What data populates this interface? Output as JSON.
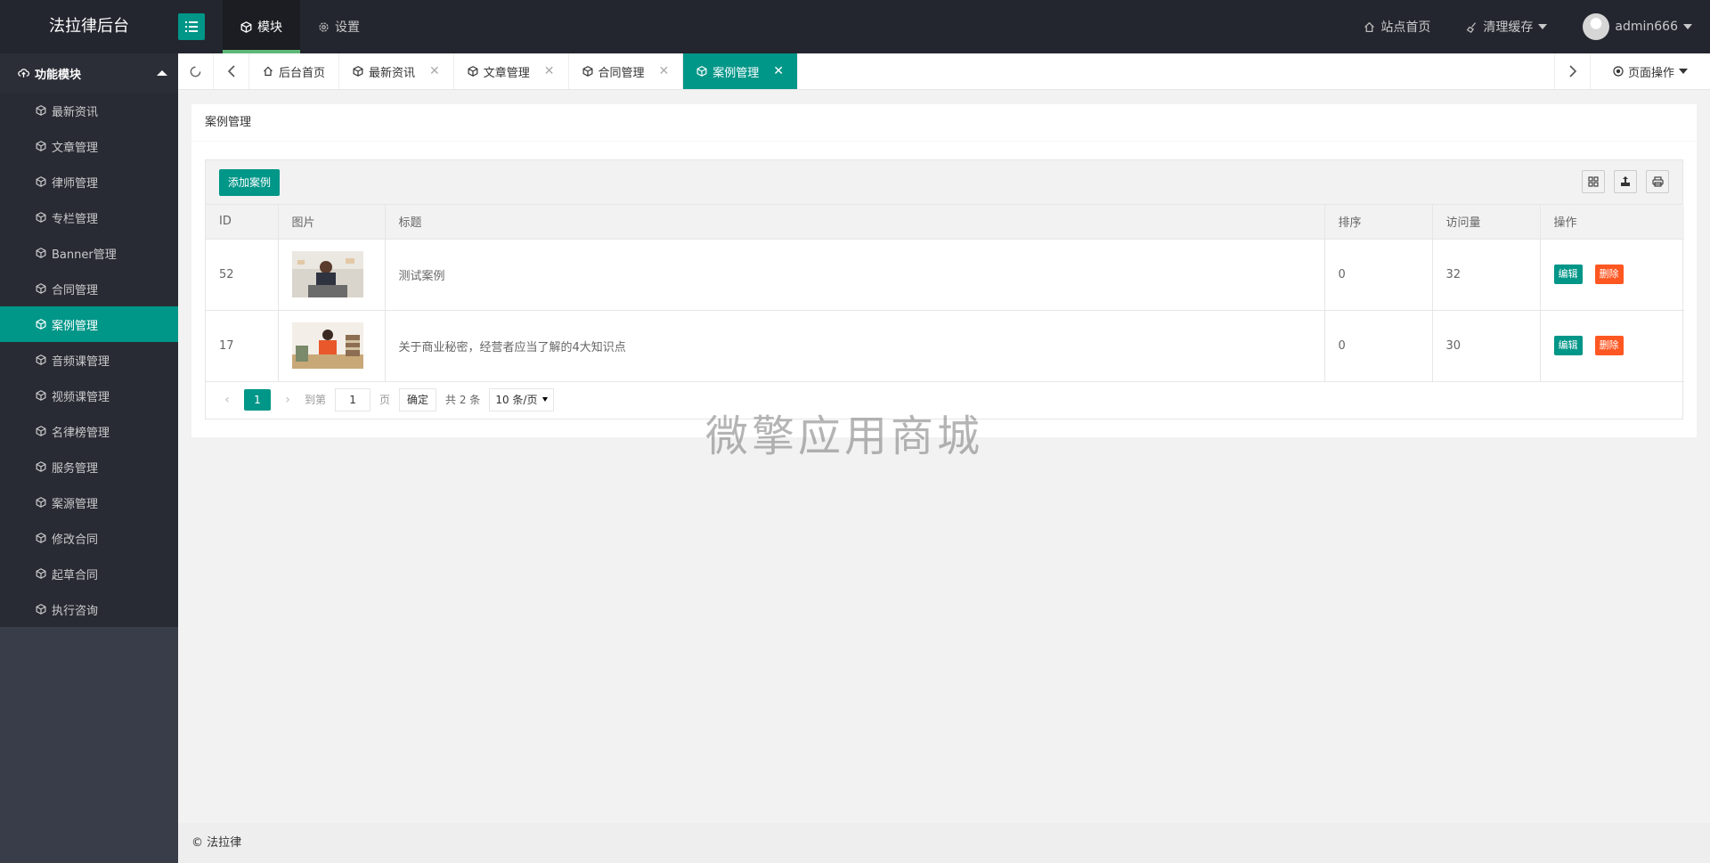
{
  "header": {
    "logo": "法拉律后台",
    "nav": [
      {
        "label": "模块",
        "icon": "cube-icon",
        "active": true
      },
      {
        "label": "设置",
        "icon": "gear-icon",
        "active": false
      }
    ],
    "right": {
      "site_home": "站点首页",
      "clear_cache": "清理缓存",
      "username": "admin666"
    }
  },
  "sidebar": {
    "group_label": "功能模块",
    "items": [
      {
        "label": "最新资讯"
      },
      {
        "label": "文章管理"
      },
      {
        "label": "律师管理"
      },
      {
        "label": "专栏管理"
      },
      {
        "label": "Banner管理"
      },
      {
        "label": "合同管理"
      },
      {
        "label": "案例管理",
        "active": true
      },
      {
        "label": "音频课管理"
      },
      {
        "label": "视频课管理"
      },
      {
        "label": "名律榜管理"
      },
      {
        "label": "服务管理"
      },
      {
        "label": "案源管理"
      },
      {
        "label": "修改合同"
      },
      {
        "label": "起草合同"
      },
      {
        "label": "执行咨询"
      }
    ]
  },
  "tabs": {
    "items": [
      {
        "label": "后台首页",
        "icon": "home-icon",
        "closable": false
      },
      {
        "label": "最新资讯",
        "icon": "cube-icon",
        "closable": true
      },
      {
        "label": "文章管理",
        "icon": "cube-icon",
        "closable": true
      },
      {
        "label": "合同管理",
        "icon": "cube-icon",
        "closable": true
      },
      {
        "label": "案例管理",
        "icon": "cube-icon",
        "closable": true,
        "active": true
      }
    ],
    "page_ops": "页面操作"
  },
  "main": {
    "card_title": "案例管理",
    "add_button": "添加案例",
    "columns": [
      "ID",
      "图片",
      "标题",
      "排序",
      "访问量",
      "操作"
    ],
    "rows": [
      {
        "id": "52",
        "title": "测试案例",
        "sort": "0",
        "views": "32",
        "edit": "编辑",
        "delete": "删除"
      },
      {
        "id": "17",
        "title": "关于商业秘密，经营者应当了解的4大知识点",
        "sort": "0",
        "views": "30",
        "edit": "编辑",
        "delete": "删除"
      }
    ],
    "pager": {
      "current": "1",
      "goto_label": "到第",
      "goto_value": "1",
      "page_suffix": "页",
      "confirm": "确定",
      "total": "共 2 条",
      "page_size": "10 条/页"
    }
  },
  "watermark": "微擎应用商城",
  "footer": "© 法拉律",
  "colors": {
    "accent": "#009688",
    "danger": "#ff5722",
    "header_bg": "#23262e",
    "sidebar_bg": "#393d49"
  }
}
